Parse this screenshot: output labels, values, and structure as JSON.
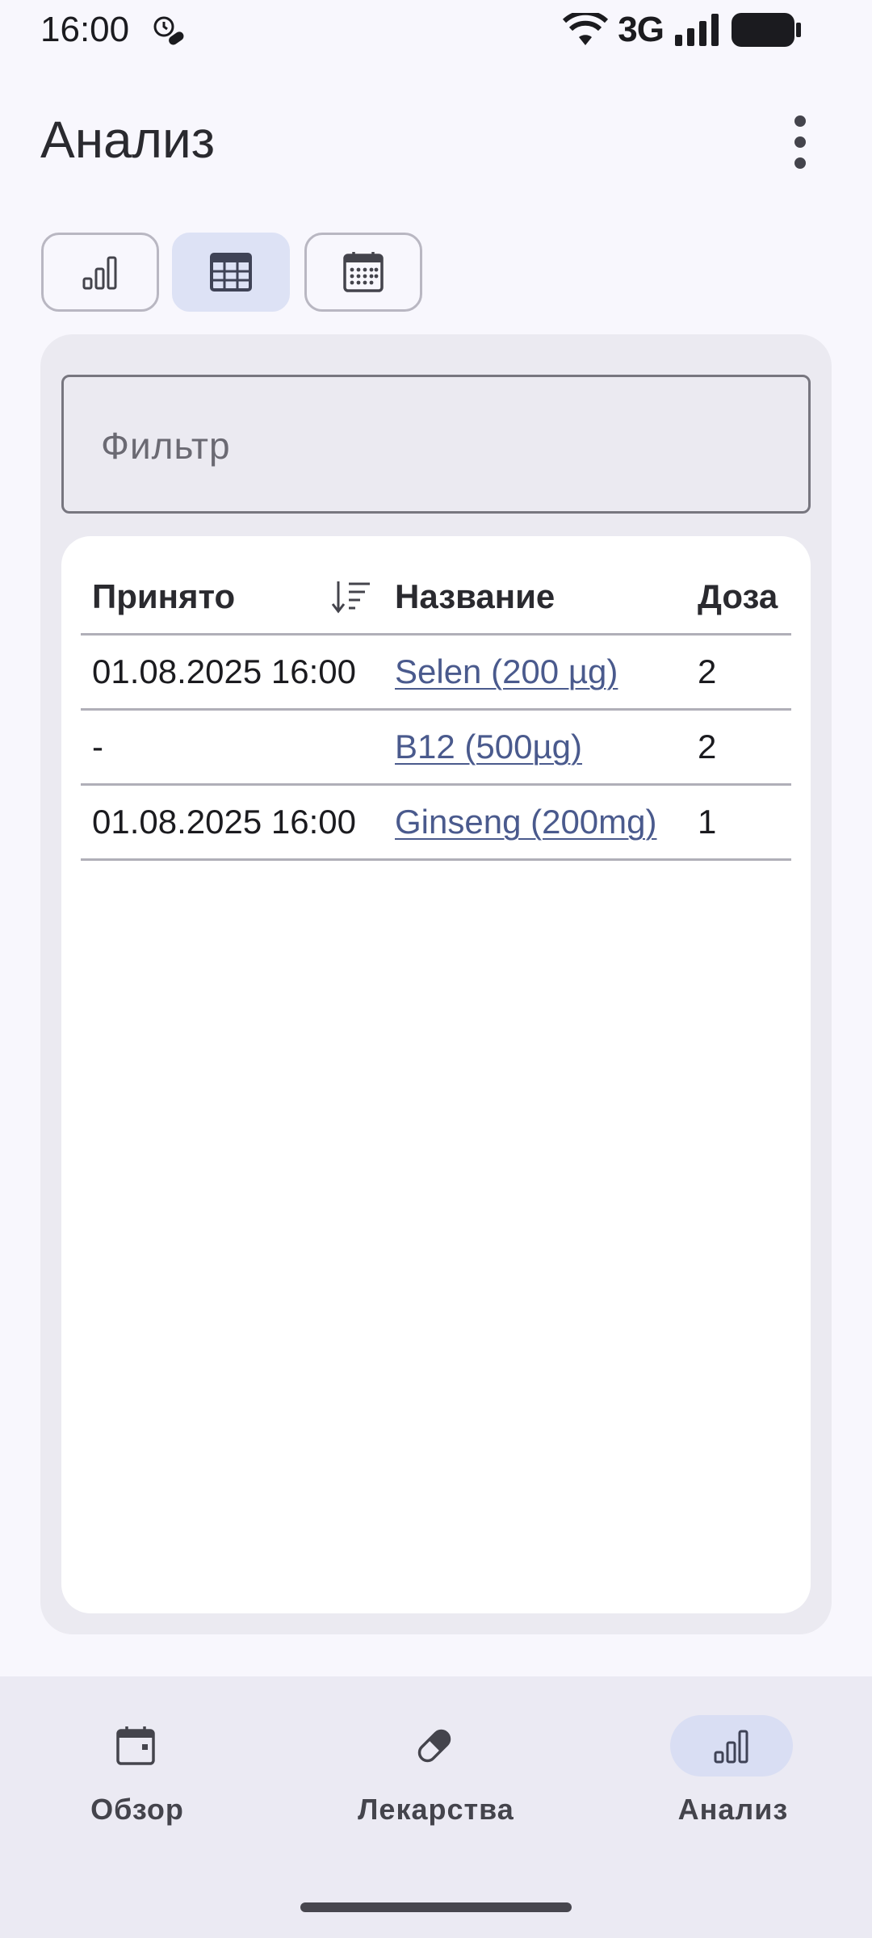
{
  "status_bar": {
    "time": "16:00",
    "network": "3G",
    "icons": [
      "alarm-icon",
      "wifi-icon",
      "signal-icon",
      "battery-icon"
    ]
  },
  "app_bar": {
    "title": "Анализ",
    "overflow_icon": "more-vert-icon"
  },
  "view_toggles": [
    {
      "icon": "bar-chart-icon",
      "selected": false
    },
    {
      "icon": "table-icon",
      "selected": true
    },
    {
      "icon": "calendar-grid-icon",
      "selected": false
    }
  ],
  "filter": {
    "placeholder": "Фильтр",
    "value": ""
  },
  "table": {
    "headers": [
      "Принято",
      "Название",
      "Доза"
    ],
    "sort_icon": "sort-descending-icon",
    "rows": [
      {
        "taken": "01.08.2025 16:00",
        "name": "Selen (200 µg)",
        "dose": "2"
      },
      {
        "taken": "-",
        "name": "B12 (500µg)",
        "dose": "2"
      },
      {
        "taken": "01.08.2025 16:00",
        "name": "Ginseng (200mg)",
        "dose": "1"
      }
    ]
  },
  "bottom_nav": {
    "items": [
      {
        "label": "Обзор",
        "icon": "calendar-icon",
        "selected": false
      },
      {
        "label": "Лекарства",
        "icon": "pill-icon",
        "selected": false
      },
      {
        "label": "Анализ",
        "icon": "bar-chart-icon",
        "selected": true
      }
    ]
  },
  "colors": {
    "background": "#f8f7fd",
    "accent_container": "#dde2f5",
    "link": "#4a5a8d",
    "surface": "#ebeaf1"
  }
}
